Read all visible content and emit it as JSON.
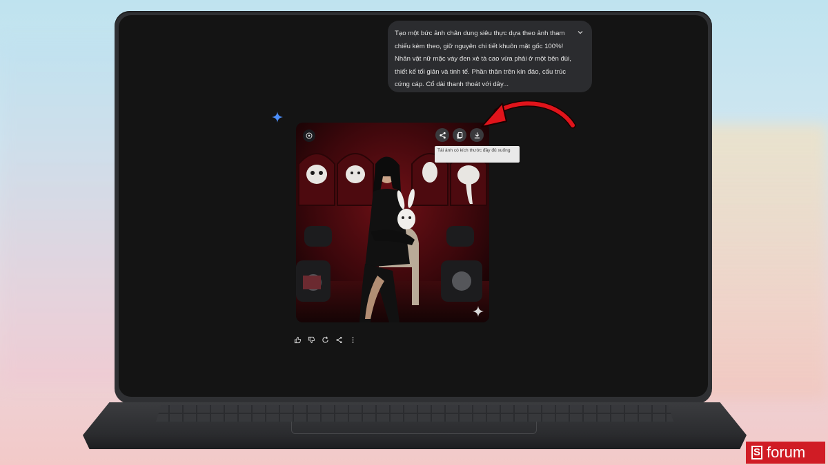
{
  "prompt": {
    "text": "Tạo một bức ảnh chân dung siêu thực dựa theo ảnh tham chiếu kèm theo, giữ nguyên chi tiết khuôn mặt gốc 100%! Nhân vật nữ mặc váy đen xẻ tà cao vừa phải ở một bên đùi, thiết kế tối giản và tinh tế. Phần thân trên kín đáo, cấu trúc cứng cáp. Cổ dài thanh thoát với dây..."
  },
  "image_actions": {
    "share_icon": "share-icon",
    "copy_icon": "copy-icon",
    "download_icon": "download-icon"
  },
  "tooltip": {
    "text": "Tải ảnh có kích thước đầy đủ xuống"
  },
  "feedback": {
    "icons": [
      "thumbs-up-icon",
      "thumbs-down-icon",
      "regenerate-icon",
      "share-icon",
      "more-vert-icon"
    ]
  },
  "branding": {
    "logo_letter": "S",
    "logo_word": "forum"
  },
  "colors": {
    "accent_red": "#d01c25",
    "gemini_blue": "#4b8df8",
    "screen_bg": "#141414"
  }
}
